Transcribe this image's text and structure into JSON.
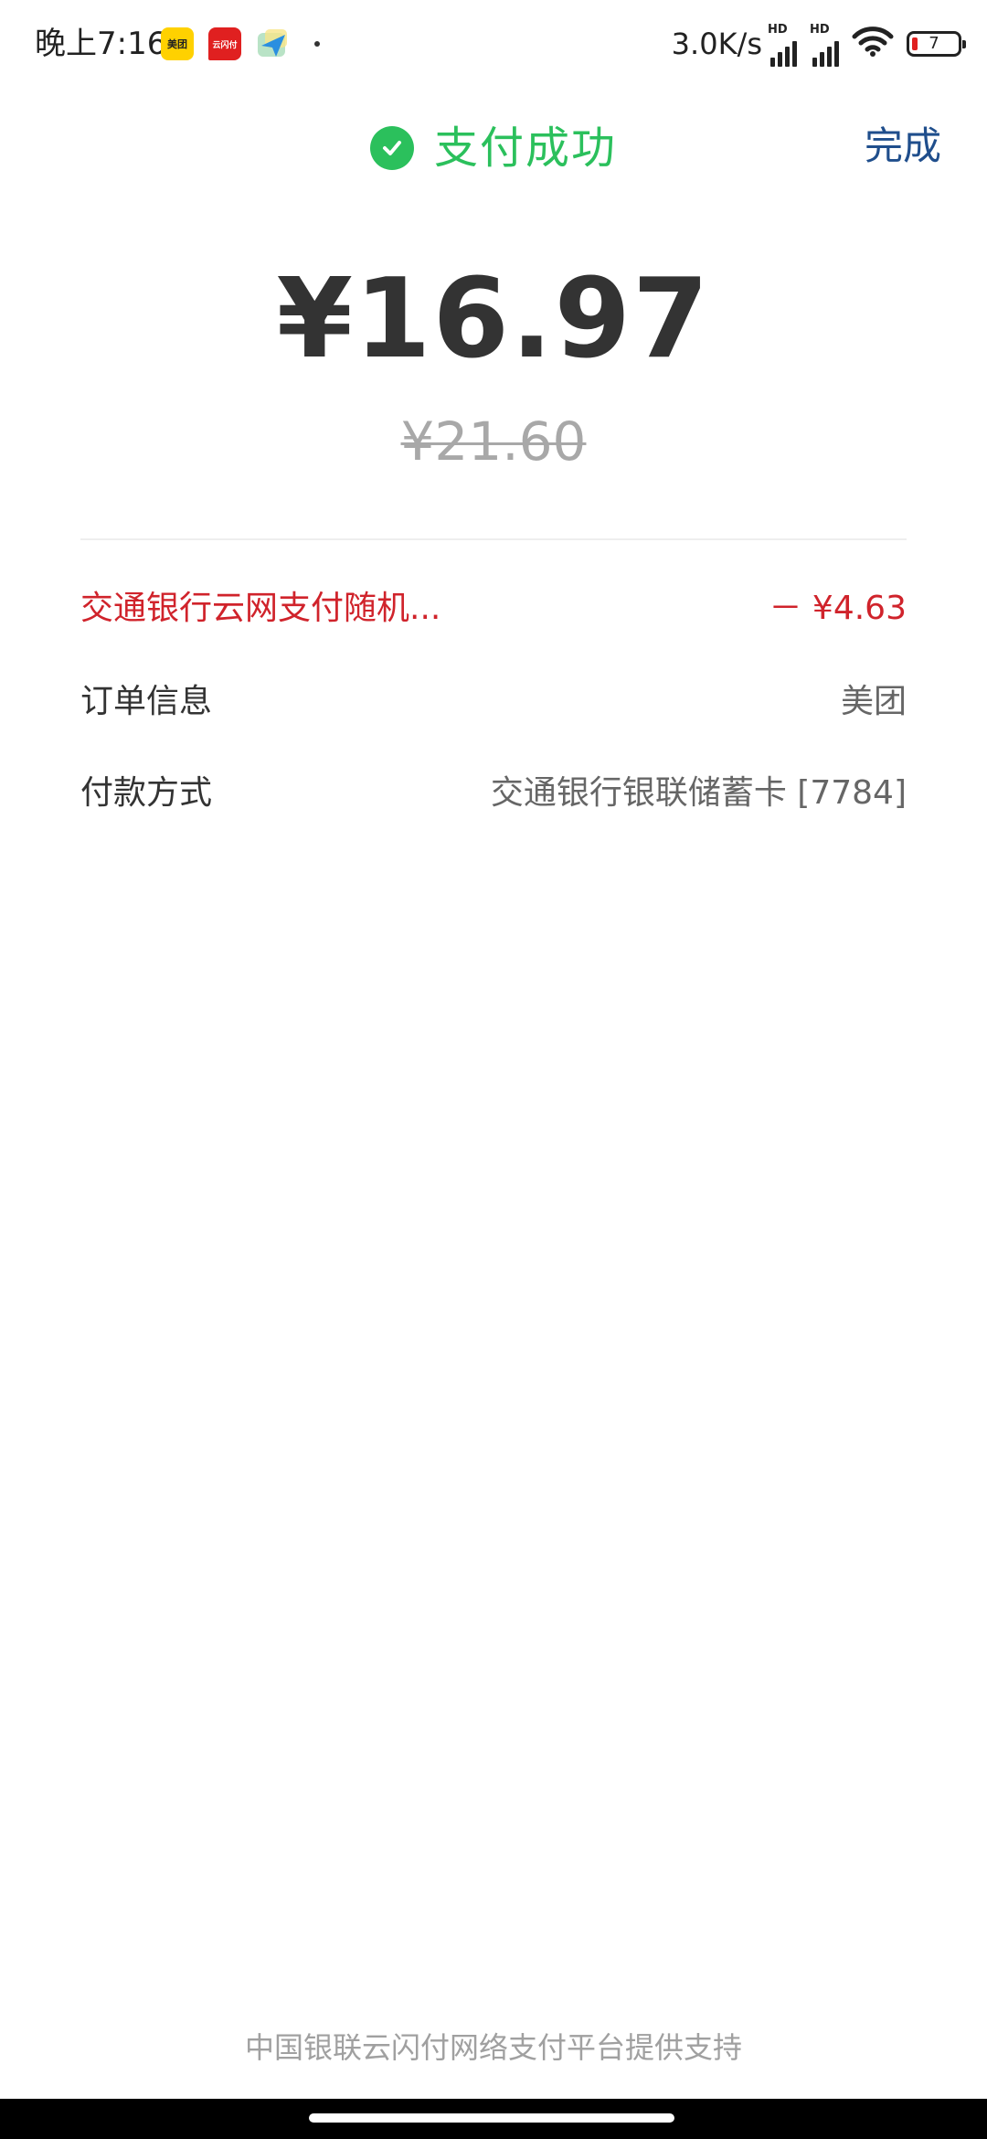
{
  "status_bar": {
    "time": "晚上7:16",
    "apps": [
      {
        "icon": "meituan-app-icon",
        "text": "美团"
      },
      {
        "icon": "yunshanfu-app-icon",
        "text": "云闪付"
      },
      {
        "icon": "paper-plane-app-icon",
        "text": ""
      }
    ],
    "net_speed": "3.0K/s",
    "signal_label_1": "HD",
    "signal_label_2": "HD",
    "battery_level": "7"
  },
  "header": {
    "title": "支付成功",
    "done_label": "完成",
    "success_color": "#2bc05c",
    "done_color": "#1f4e8c"
  },
  "payment": {
    "amount": "¥16.97",
    "original_amount": "¥21.60"
  },
  "details": [
    {
      "label": "交通银行云网支付随机...",
      "value": "－ ¥4.63",
      "color": "#d0232b"
    },
    {
      "label": "订单信息",
      "value": "美团"
    },
    {
      "label": "付款方式",
      "value": "交通银行银联储蓄卡 [7784]"
    }
  ],
  "footer": {
    "note": "中国银联云闪付网络支付平台提供支持"
  }
}
